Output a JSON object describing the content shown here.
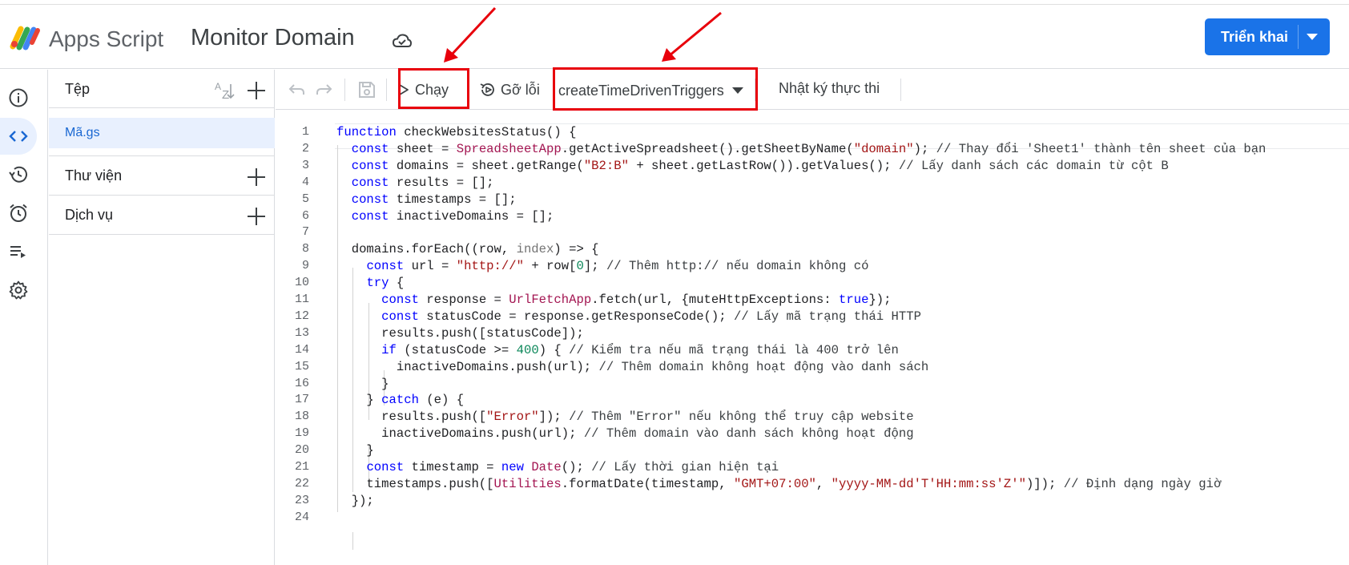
{
  "header": {
    "app_name": "Apps Script",
    "project_name": "Monitor Domain",
    "deploy_label": "Triển khai"
  },
  "rail": {
    "items": [
      "info-icon",
      "code-icon",
      "history-icon",
      "alarm-icon",
      "executions-icon",
      "settings-icon"
    ],
    "active": "code-icon"
  },
  "files": {
    "title": "Tệp",
    "items": [
      {
        "label": "Mã.gs",
        "selected": true
      }
    ],
    "libraries_label": "Thư viện",
    "services_label": "Dịch vụ"
  },
  "toolbar": {
    "run_label": "Chạy",
    "debug_label": "Gỡ lỗi",
    "function_selected": "createTimeDrivenTriggers",
    "log_label": "Nhật ký thực thi"
  },
  "code": {
    "lines": [
      "function checkWebsitesStatus() {",
      "  const sheet = SpreadsheetApp.getActiveSpreadsheet().getSheetByName(\"domain\"); // Thay đổi 'Sheet1' thành tên sheet của bạn",
      "  const domains = sheet.getRange(\"B2:B\" + sheet.getLastRow()).getValues(); // Lấy danh sách các domain từ cột B",
      "  const results = [];",
      "  const timestamps = [];",
      "  const inactiveDomains = [];",
      "",
      "  domains.forEach((row, index) => {",
      "    const url = \"http://\" + row[0]; // Thêm http:// nếu domain không có",
      "    try {",
      "      const response = UrlFetchApp.fetch(url, {muteHttpExceptions: true});",
      "      const statusCode = response.getResponseCode(); // Lấy mã trạng thái HTTP",
      "      results.push([statusCode]);",
      "      if (statusCode >= 400) { // Kiểm tra nếu mã trạng thái là 400 trở lên",
      "        inactiveDomains.push(url); // Thêm domain không hoạt động vào danh sách",
      "      }",
      "    } catch (e) {",
      "      results.push([\"Error\"]); // Thêm \"Error\" nếu không thể truy cập website",
      "      inactiveDomains.push(url); // Thêm domain vào danh sách không hoạt động",
      "    }",
      "    const timestamp = new Date(); // Lấy thời gian hiện tại",
      "    timestamps.push([Utilities.formatDate(timestamp, \"GMT+07:00\", \"yyyy-MM-dd'T'HH:mm:ss'Z'\")]); // Định dạng ngày giờ",
      "  });",
      ""
    ]
  },
  "annotation_color": "#e8000b",
  "accent_color": "#1a73e8"
}
